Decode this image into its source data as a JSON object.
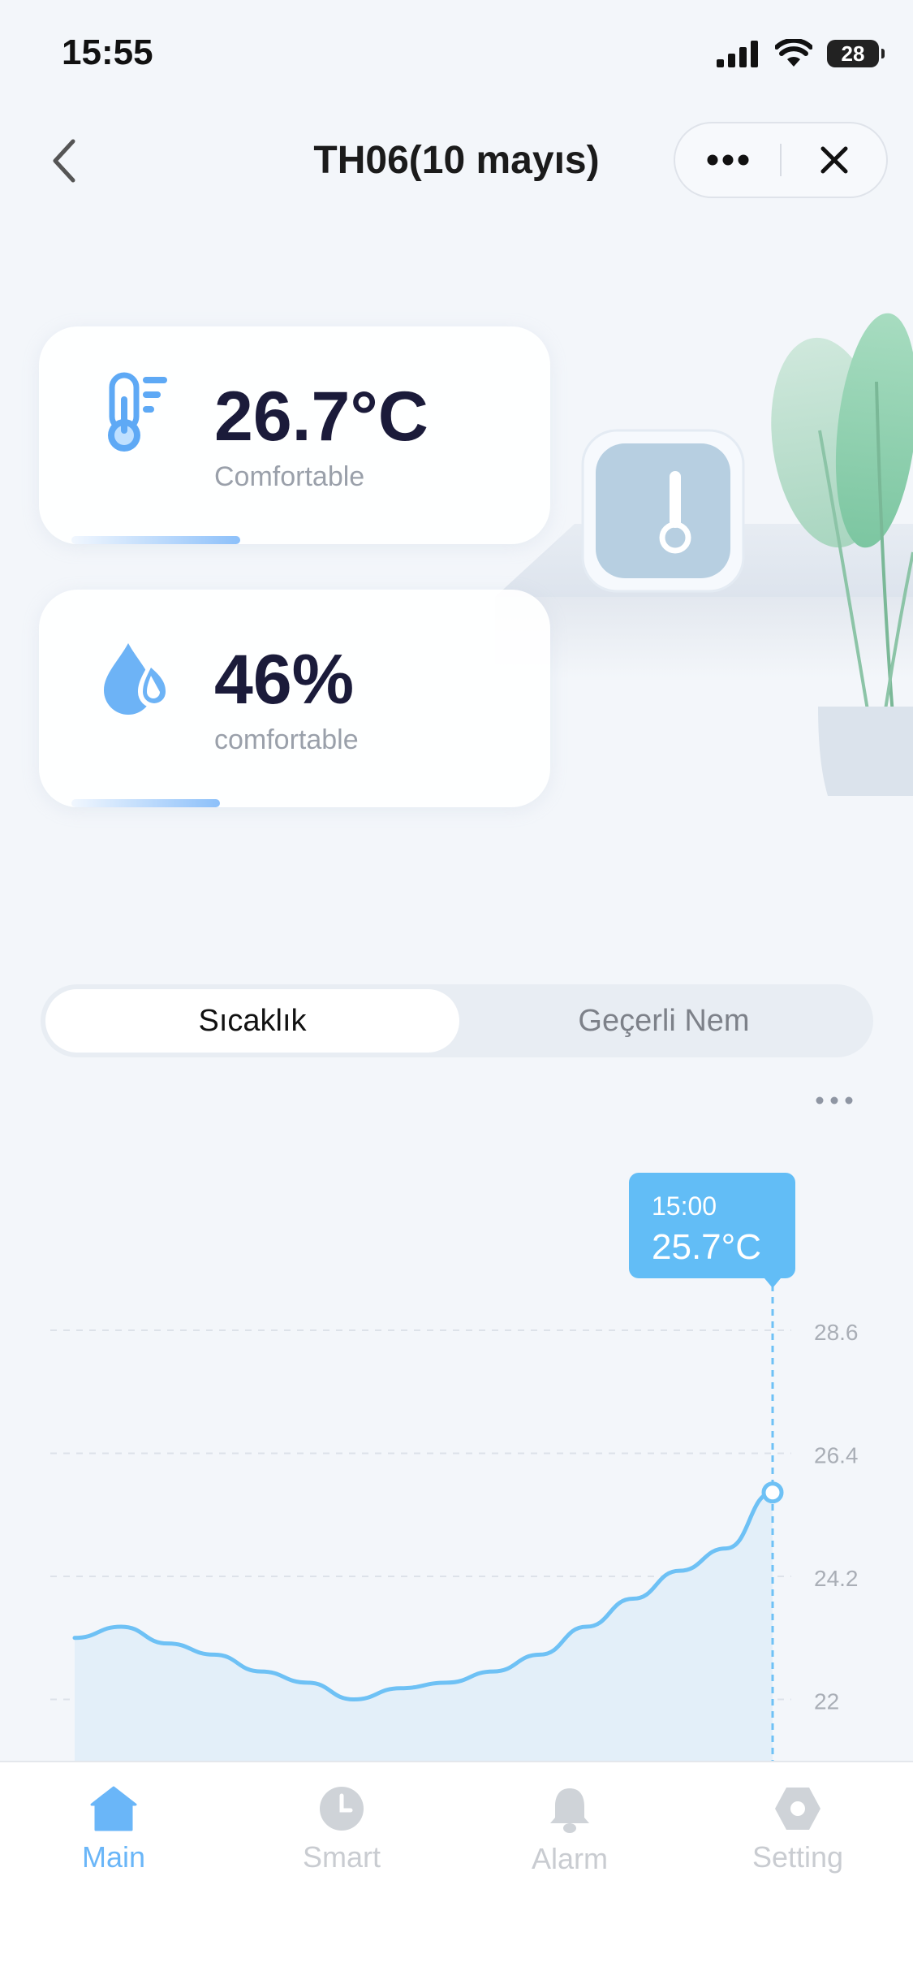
{
  "status_bar": {
    "time": "15:55",
    "battery": "28"
  },
  "nav": {
    "title": "TH06(10 mayıs)"
  },
  "cards": [
    {
      "value": "26.7°C",
      "caption": "Comfortable",
      "icon": "thermometer-icon",
      "level": 0.33
    },
    {
      "value": "46%",
      "caption": "comfortable",
      "icon": "water-drop-icon",
      "level": 0.29
    }
  ],
  "tabs": {
    "active": "Sıcaklık",
    "inactive": "Geçerli Nem"
  },
  "chart_data": {
    "type": "area",
    "yticks": [
      28.6,
      26.4,
      24.2,
      22
    ],
    "ylim": [
      20.3,
      30.0
    ],
    "x": [
      0,
      1,
      2,
      3,
      4,
      5,
      6,
      7,
      8,
      9,
      10,
      11,
      12,
      13,
      14,
      15
    ],
    "values": [
      23.1,
      23.3,
      23.0,
      22.8,
      22.5,
      22.3,
      22.0,
      22.2,
      22.3,
      22.5,
      22.8,
      23.3,
      23.8,
      24.3,
      24.7,
      25.7
    ],
    "tooltip": {
      "time": "15:00",
      "value": "25.7°C"
    },
    "grid": true,
    "color": "#6ec1f5"
  },
  "tabbar": [
    {
      "label": "Main",
      "icon": "home-icon",
      "active": true
    },
    {
      "label": "Smart",
      "icon": "clock-icon",
      "active": false
    },
    {
      "label": "Alarm",
      "icon": "bell-icon",
      "active": false
    },
    {
      "label": "Setting",
      "icon": "gear-icon",
      "active": false
    }
  ],
  "colors": {
    "accent": "#6ab6f8",
    "card_value": "#1b1b3a",
    "inactive": "#c9ccd1"
  }
}
